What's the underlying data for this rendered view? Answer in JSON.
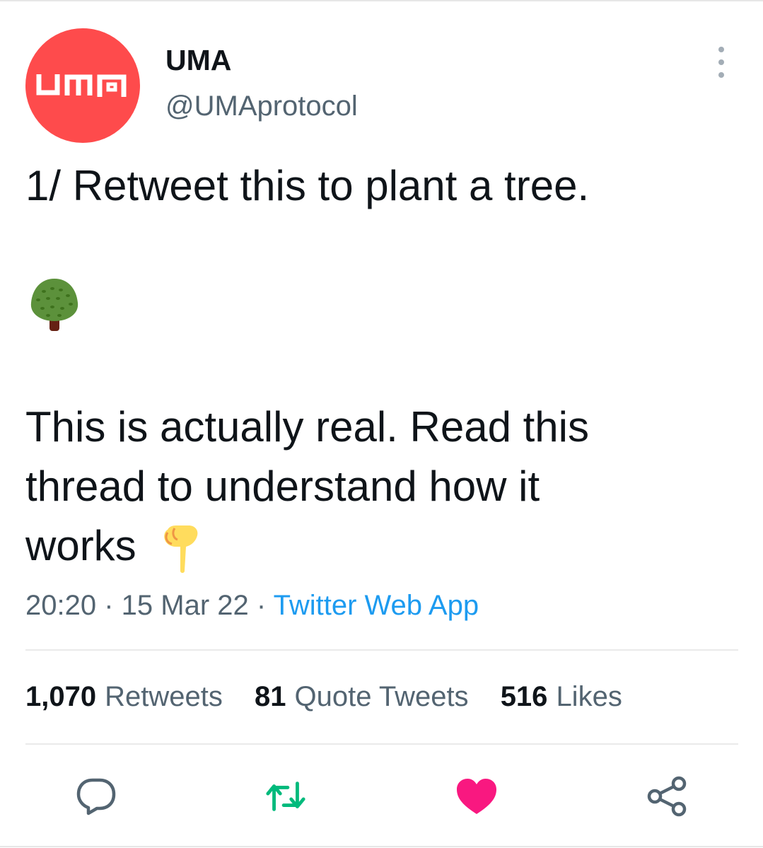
{
  "author": {
    "avatar_logo_text": "UMA",
    "display_name": "UMA",
    "handle": "@UMAprotocol"
  },
  "tweet": {
    "line_1": "1/ Retweet this to plant a tree.",
    "emoji_1": "deciduous-tree-emoji",
    "line_2": "This is actually real. Read this",
    "line_3": "thread to understand how it",
    "line_4": "works",
    "emoji_2": "pointing-down-emoji"
  },
  "meta": {
    "time": "20:20",
    "sep_1": " · ",
    "date": "15 Mar 22",
    "sep_2": " · ",
    "source": "Twitter Web App"
  },
  "stats": {
    "retweets_count": "1,070",
    "retweets_label": "Retweets",
    "quotes_count": "81",
    "quotes_label": "Quote Tweets",
    "likes_count": "516",
    "likes_label": "Likes"
  },
  "colors": {
    "avatar_bg": "#fe4b4c",
    "link_blue": "#1d9bf0",
    "retweet_green": "#00ba7c",
    "like_pink": "#f91880",
    "secondary_text": "#536471"
  },
  "actions": [
    "reply-icon",
    "retweet-icon",
    "like-icon",
    "share-icon"
  ]
}
